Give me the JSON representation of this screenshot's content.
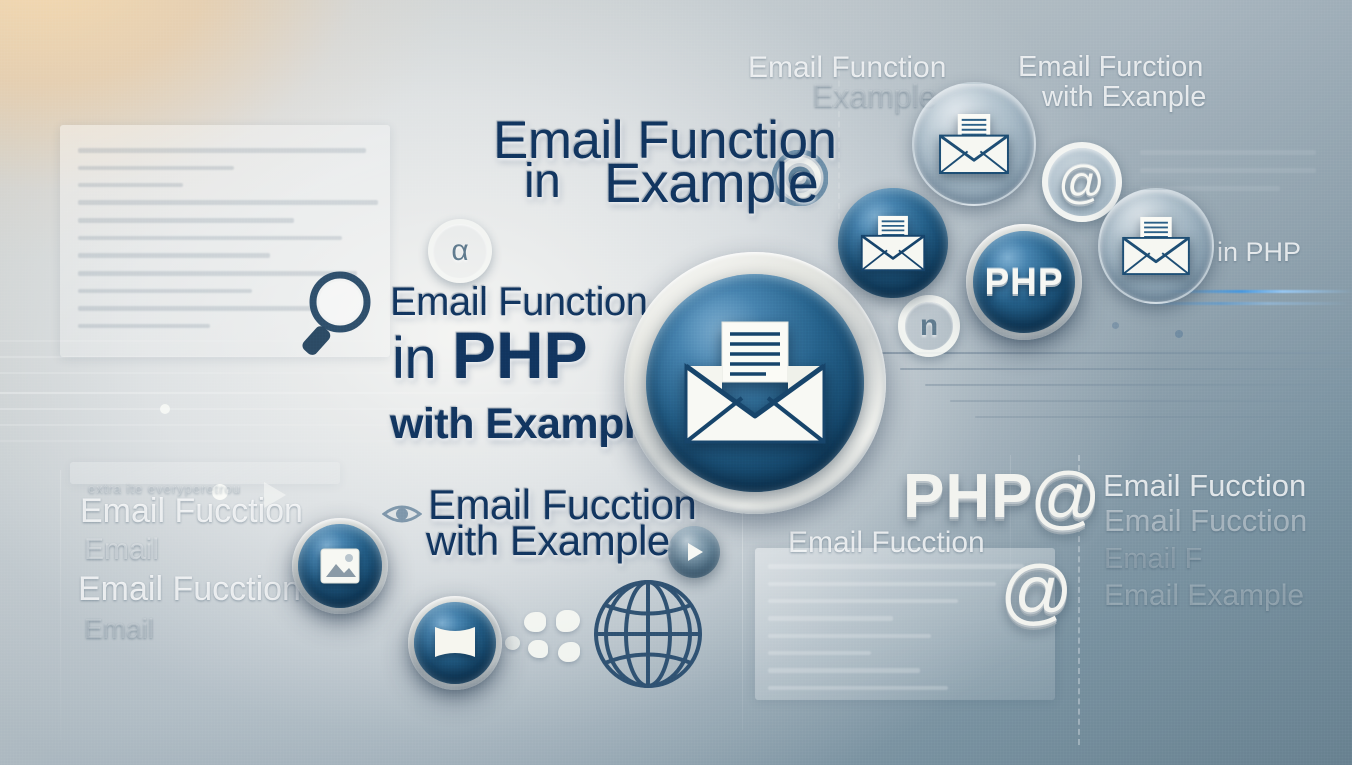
{
  "scene": {
    "title": "Email Function in PHP with Example",
    "palette": {
      "deep_blue": "#12355f",
      "badge_blue": "#1d5580",
      "warm_corner": "#f0d3a8",
      "slate_corner": "#5b7384",
      "white_text": "#f4f5f1"
    }
  },
  "headline": {
    "line1": "Email Function",
    "line2": "in PHP",
    "line2_prefix": "in ",
    "line2_php": "PHP",
    "line3": "with Example"
  },
  "top_headline": {
    "line1": "Email Function",
    "line2_in": "in",
    "line2_example": "Example"
  },
  "bottom_headline": {
    "line1": "Email Fucction",
    "line2": "with Example"
  },
  "ghost_labels": {
    "top_center_1": "Email Function",
    "top_center_2": "Example",
    "top_right_1": "Email Furction",
    "top_right_2": "with Exanple",
    "right_in_php": "in PHP",
    "left_small_header": "extra ite everyperetrou",
    "left_1": "Email Fucction",
    "left_2": "Email",
    "left_3": "Email Fucction",
    "left_4": "Email",
    "right_col_1": "Email Fucction",
    "right_col_2": "Email Fucction",
    "right_col_3": "Email F",
    "right_col_4": "Email Example",
    "bottom_mid": "Email Fucction"
  },
  "emboss_labels": {
    "php": "PHP",
    "at": "@",
    "at_lower": "@"
  },
  "badges": [
    {
      "name": "main-email-badge",
      "icon": "envelope-document-icon",
      "label": ""
    },
    {
      "name": "email-badge-top",
      "icon": "envelope-document-icon",
      "label": ""
    },
    {
      "name": "email-badge-left",
      "icon": "envelope-document-icon",
      "label": ""
    },
    {
      "name": "php-badge",
      "icon": "",
      "label": "PHP"
    },
    {
      "name": "email-badge-right",
      "icon": "envelope-document-icon",
      "label": ""
    },
    {
      "name": "at-badge",
      "icon": "at-icon",
      "label": "@"
    },
    {
      "name": "photo-badge",
      "icon": "image-icon",
      "label": ""
    },
    {
      "name": "flag-badge",
      "icon": "flag-icon",
      "label": ""
    },
    {
      "name": "play-badge",
      "icon": "play-icon",
      "label": ""
    }
  ],
  "ring_glyphs": {
    "alpha": "α",
    "n": "n"
  },
  "icons": {
    "magnifier": "search-icon",
    "globe": "globe-icon",
    "target": "target-icon",
    "play": "play-icon"
  }
}
